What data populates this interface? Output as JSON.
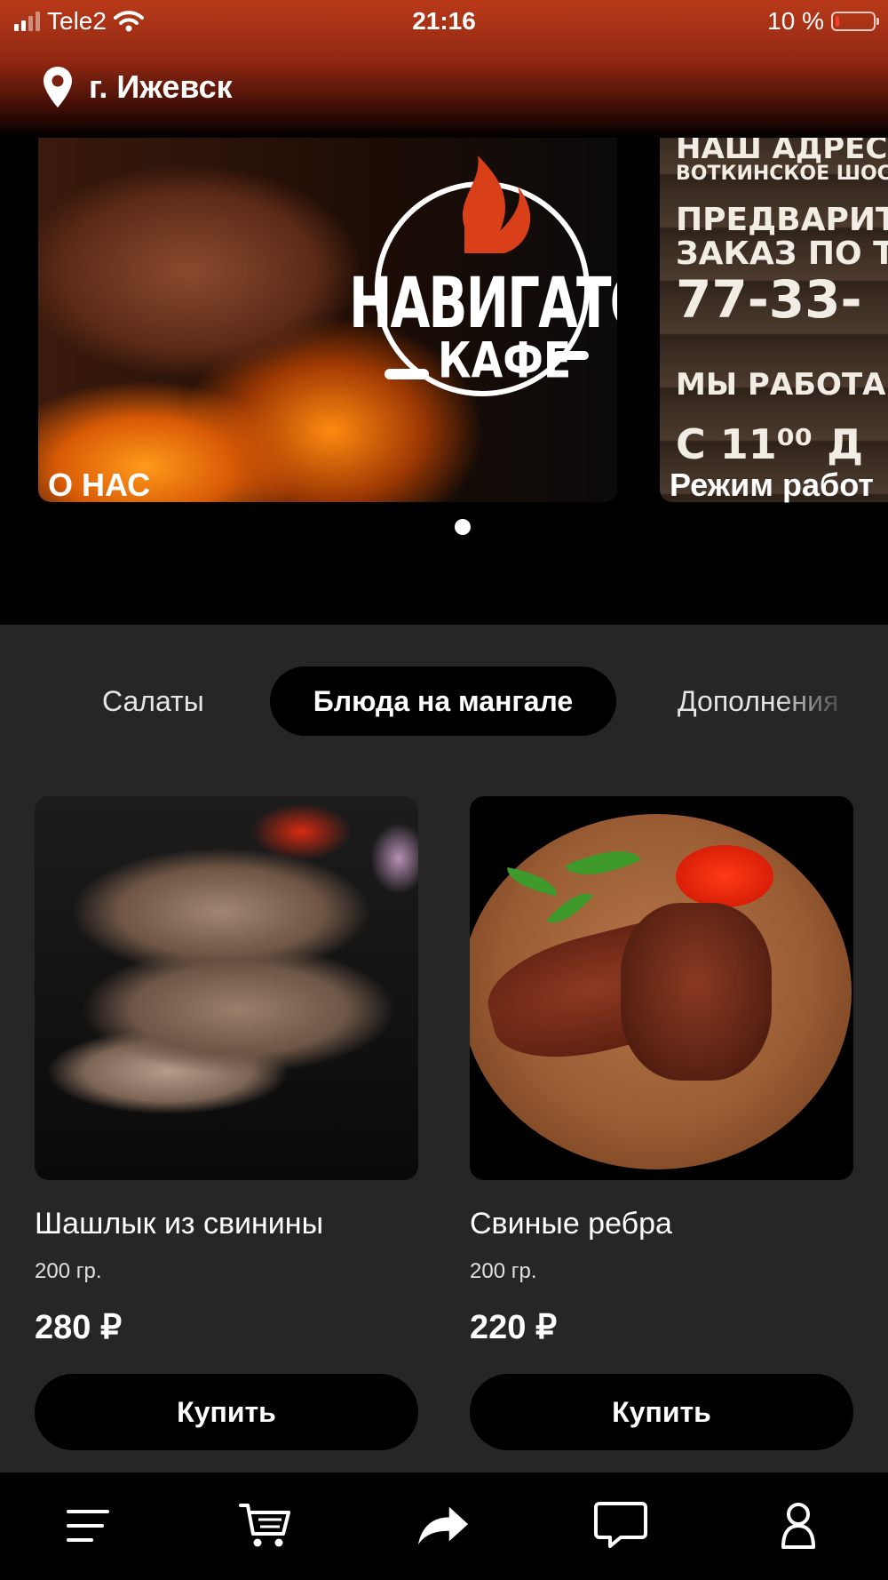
{
  "status_bar": {
    "carrier": "Tele2",
    "time": "21:16",
    "battery_percent": "10 %",
    "battery_level": 0.1,
    "signal_icon": "signal-icon",
    "wifi_icon": "wifi-icon"
  },
  "header": {
    "city": "г. Ижевск",
    "location_icon": "location-pin-icon"
  },
  "banners": [
    {
      "caption": "О НАС",
      "logo_title": "НАВИГАТОР",
      "logo_subtitle": "КАФЕ"
    },
    {
      "caption": "Режим работ",
      "chalk_lines": [
        "НАШ АДРЕС",
        "ВОТКИНСКОЕ ШОСС",
        "ПРЕДВАРИТ",
        "ЗАКАЗ ПО Т",
        "77-33-",
        "МЫ РАБОТА",
        "С 11⁰⁰ Д"
      ]
    }
  ],
  "carousel": {
    "active_page": 1
  },
  "categories": {
    "tabs": [
      "Салаты",
      "Блюда на мангале",
      "Дополнения"
    ],
    "active": "Блюда на мангале"
  },
  "products": [
    {
      "name": "Шашлык из свинины",
      "weight": "200 гр.",
      "price": "280 ₽",
      "buy_label": "Купить"
    },
    {
      "name": "Свиные ребра",
      "weight": "200 гр.",
      "price": "220 ₽",
      "buy_label": "Купить"
    }
  ],
  "bottom_nav": {
    "items": [
      "menu-icon",
      "cart-icon",
      "share-icon",
      "chat-icon",
      "profile-icon"
    ]
  },
  "colors": {
    "header_top": "#b93a19",
    "content_bg": "#262626",
    "button_bg": "#000000",
    "battery_low": "#ff3b30"
  }
}
